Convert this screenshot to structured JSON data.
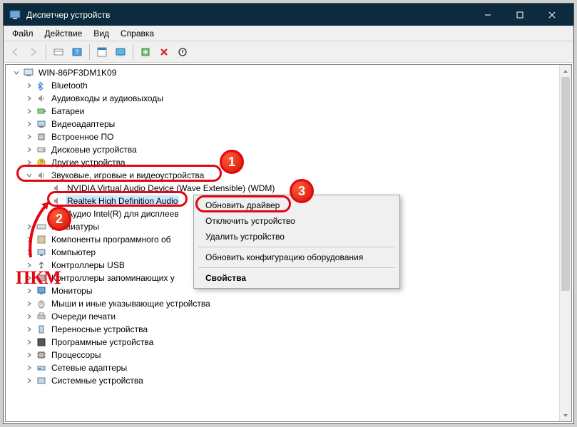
{
  "window": {
    "title": "Диспетчер устройств"
  },
  "menus": {
    "file": "Файл",
    "action": "Действие",
    "view": "Вид",
    "help": "Справка"
  },
  "tree": {
    "root": "WIN-86PF3DM1K09",
    "nodes": {
      "bt": "Bluetooth",
      "audio_io": "Аудиовходы и аудиовыходы",
      "battery": "Батареи",
      "video": "Видеоадаптеры",
      "firmware": "Встроенное ПО",
      "disk": "Дисковые устройства",
      "other": "Другие устройства",
      "sound": "Звуковые, игровые и видеоустройства",
      "sound_nvidia": "NVIDIA Virtual Audio Device (Wave Extensible) (WDM)",
      "sound_realtek": "Realtek High Definition Audio",
      "sound_intel": "Аудио Intel(R) для дисплеев",
      "keyboard": "Клавиатуры",
      "software": "Компоненты программного об",
      "computer": "Компьютер",
      "usb": "Контроллеры USB",
      "storage_ctrl": "Контроллеры запоминающих у",
      "monitor": "Мониторы",
      "mouse": "Мыши и иные указывающие устройства",
      "print_q": "Очереди печати",
      "hid": "Переносные устройства",
      "software_dev": "Программные устройства",
      "cpu": "Процессоры",
      "network": "Сетевые адаптеры",
      "system": "Системные устройства"
    }
  },
  "context_menu": {
    "update": "Обновить драйвер",
    "disable": "Отключить устройство",
    "remove": "Удалить устройство",
    "rescan": "Обновить конфигурацию оборудования",
    "props": "Свойства"
  },
  "annotations": {
    "pkm": "ПКМ",
    "b1": "1",
    "b2": "2",
    "b3": "3"
  }
}
